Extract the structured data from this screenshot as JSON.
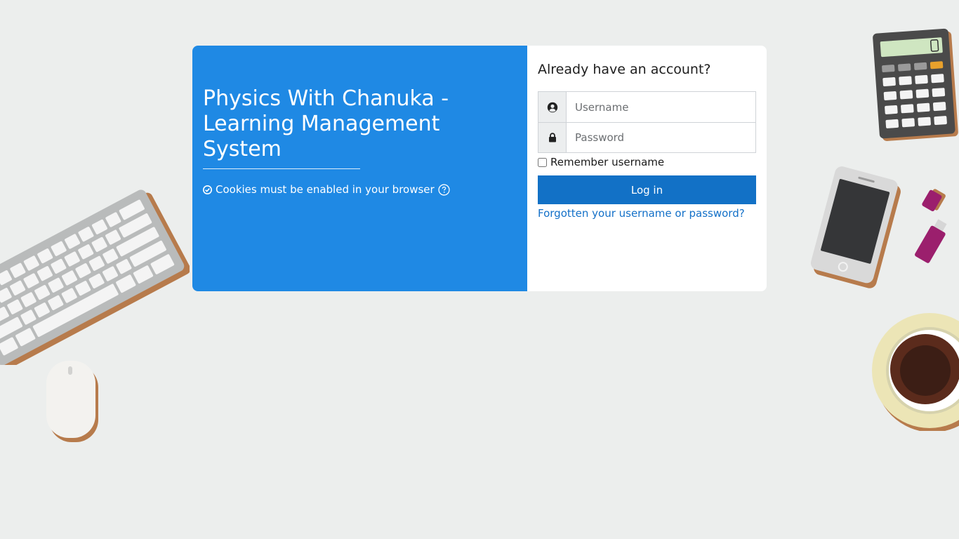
{
  "branding": {
    "site_title": "Physics With Chanuka - Learning Management System",
    "cookie_notice": "Cookies must be enabled in your browser"
  },
  "login": {
    "heading": "Already have an account?",
    "username_placeholder": "Username",
    "password_placeholder": "Password",
    "remember_label": "Remember username",
    "login_button": "Log in",
    "forgot_link": "Forgotten your username or password?"
  },
  "colors": {
    "brand_panel": "#1f89e4",
    "button": "#1271c6",
    "link": "#1370c8",
    "background": "#eceeed"
  },
  "icons": {
    "username": "user-circle-icon",
    "password": "lock-icon",
    "cookie": "check-circle-icon",
    "help": "question-circle-icon"
  }
}
